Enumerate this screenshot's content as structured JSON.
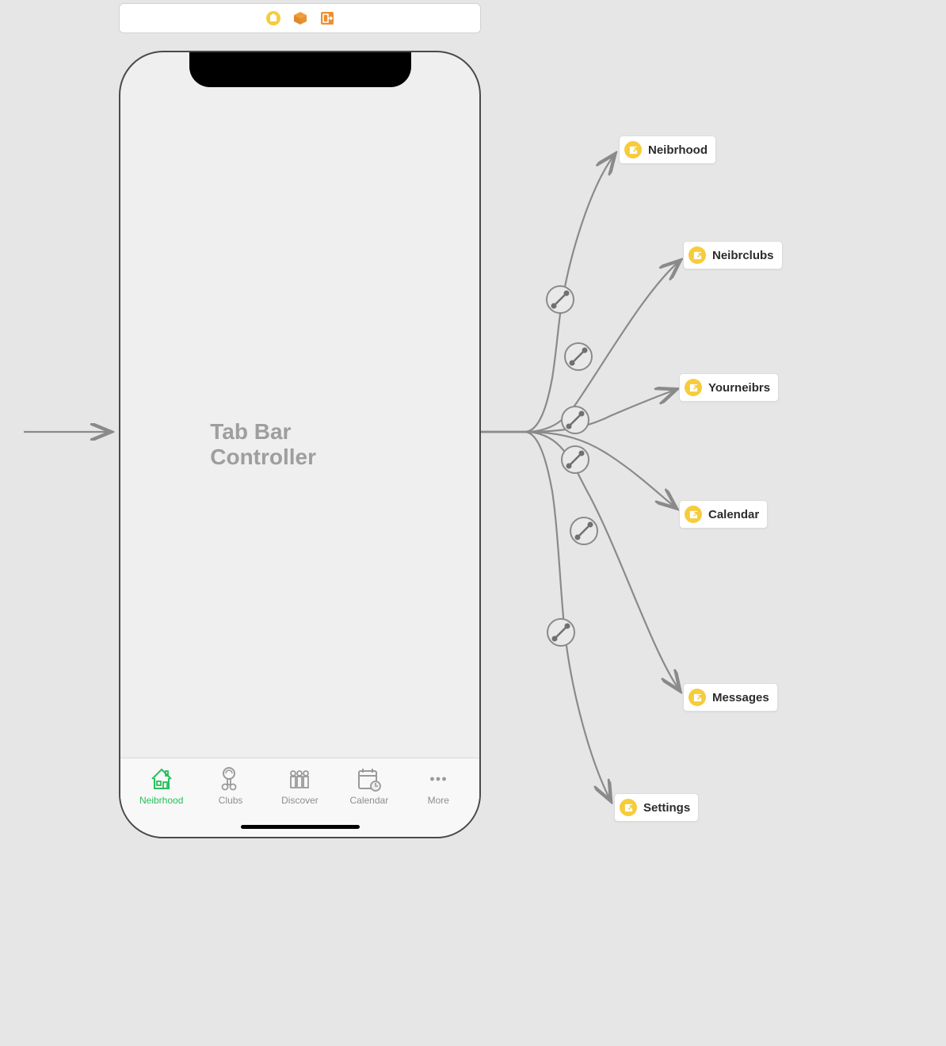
{
  "toolbar": {
    "icons": [
      "storyboard-ref-icon",
      "scene-icon",
      "exit-icon"
    ]
  },
  "phone": {
    "controller_title": "Tab Bar Controller",
    "tabs": [
      {
        "label": "Neibrhood",
        "active": true,
        "icon": "house-icon"
      },
      {
        "label": "Clubs",
        "active": false,
        "icon": "clubs-icon"
      },
      {
        "label": "Discover",
        "active": false,
        "icon": "discover-icon"
      },
      {
        "label": "Calendar",
        "active": false,
        "icon": "calendar-icon"
      },
      {
        "label": "More",
        "active": false,
        "icon": "more-icon"
      }
    ]
  },
  "segues": [
    {
      "label": "Neibrhood"
    },
    {
      "label": "Neibrclubs"
    },
    {
      "label": "Yourneibrs"
    },
    {
      "label": "Calendar"
    },
    {
      "label": "Messages"
    },
    {
      "label": "Settings"
    }
  ]
}
